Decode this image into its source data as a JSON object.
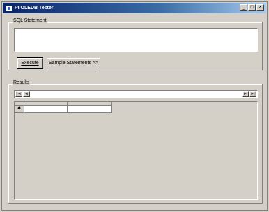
{
  "window": {
    "title": "PI OLEDB Tester",
    "minimize": "_",
    "maximize": "□",
    "close": "×"
  },
  "sql_group": {
    "label": "SQL Statement",
    "value": ""
  },
  "buttons": {
    "execute_label": "Execute",
    "sample_label": "Sample Statements >>"
  },
  "results": {
    "label": "Results",
    "nav": {
      "first": "|◄",
      "prev": "◄",
      "next": "►",
      "last": "►|"
    },
    "row_indicator": "✱"
  }
}
